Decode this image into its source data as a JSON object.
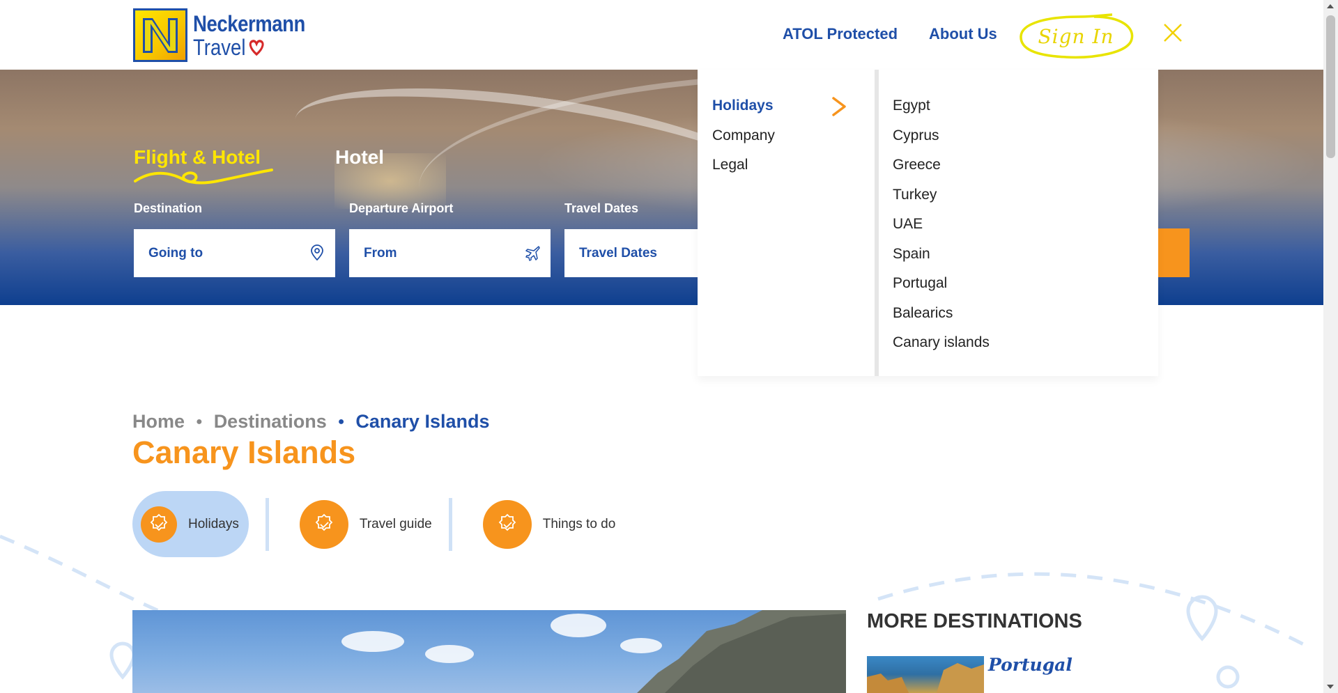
{
  "header": {
    "logo_line1": "Neckermann",
    "logo_line2": "Travel",
    "nav_atol": "ATOL Protected",
    "nav_about": "About Us",
    "signin": "Sign In"
  },
  "search": {
    "tabs": [
      {
        "label": "Flight & Hotel",
        "active": true
      },
      {
        "label": "Hotel",
        "active": false
      }
    ],
    "labels": {
      "destination": "Destination",
      "departure": "Departure Airport",
      "dates": "Travel Dates"
    },
    "fields": {
      "destination": "Going to",
      "departure": "From",
      "dates": "Travel Dates"
    }
  },
  "menu": {
    "primary": [
      {
        "label": "Holidays",
        "active": true
      },
      {
        "label": "Company",
        "active": false
      },
      {
        "label": "Legal",
        "active": false
      }
    ],
    "secondary": [
      "Egypt",
      "Cyprus",
      "Greece",
      "Turkey",
      "UAE",
      "Spain",
      "Portugal",
      "Balearics",
      "Canary islands"
    ]
  },
  "breadcrumb": [
    "Home",
    "Destinations",
    "Canary Islands"
  ],
  "page_title": "Canary Islands",
  "subtabs": [
    {
      "label": "Holidays",
      "active": true
    },
    {
      "label": "Travel guide",
      "active": false
    },
    {
      "label": "Things to do",
      "active": false
    }
  ],
  "more_destinations": {
    "title": "MORE DESTINATIONS",
    "items": [
      "Portugal"
    ]
  },
  "colors": {
    "brand_blue": "#1f4fa8",
    "accent_orange": "#f7941d",
    "accent_yellow": "#ffe600",
    "active_tab_bg": "#bcd6f5"
  },
  "icons": {
    "close": "close-icon",
    "location": "location-pin-icon",
    "plane": "plane-icon",
    "chevron": "chevron-right-icon",
    "badge": "verified-badge-icon"
  }
}
